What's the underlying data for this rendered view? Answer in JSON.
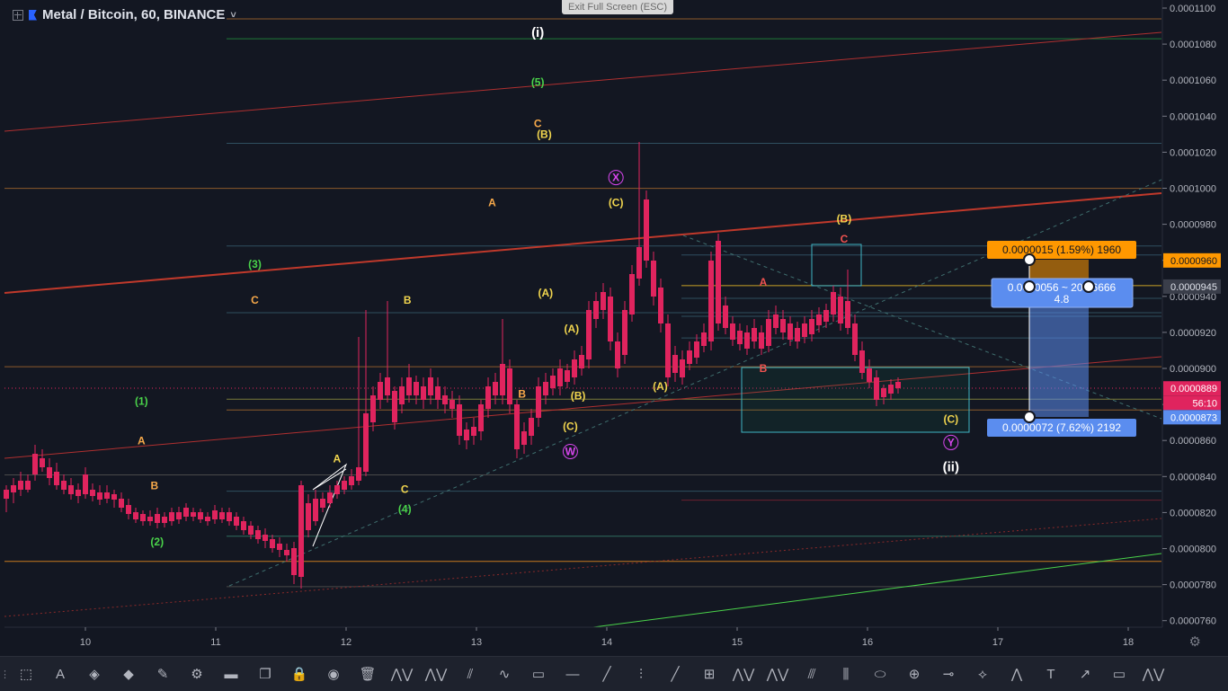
{
  "header": {
    "symbol_title": "Metal / Bitcoin, 60, BINANCE",
    "dropdown_glyph": "˅"
  },
  "fullscreen": {
    "exit_label": "Exit Full Screen (ESC)"
  },
  "colors": {
    "background": "#131722",
    "up_candle": "#26de6f",
    "down_candle": "#e0245e",
    "axis_text": "#b2b5be",
    "label_orange": "#f7a94a",
    "label_yellow": "#f1d54e",
    "label_green": "#4ad34a",
    "label_white": "#ffffff",
    "label_magenta": "#d946ef",
    "label_red": "#ef5350"
  },
  "price_axis": {
    "ticks": [
      "0.0001100",
      "0.0001080",
      "0.0001060",
      "0.0001040",
      "0.0001020",
      "0.0001000",
      "0.0000980",
      "0.0000960",
      "0.0000940",
      "0.0000920",
      "0.0000900",
      "0.0000880",
      "0.0000860",
      "0.0000840",
      "0.0000820",
      "0.0000800",
      "0.0000780",
      "0.0000760"
    ],
    "badges": [
      {
        "text": "0.0000960",
        "price": 9.6e-05,
        "bg": "#ff9800",
        "fg": "#131722"
      },
      {
        "text": "0.0000945",
        "price": 9.455e-05,
        "bg": "#3a3e4a",
        "fg": "#e0e3eb"
      },
      {
        "text": "0.0000889",
        "price": 8.89e-05,
        "bg": "#e0245e",
        "fg": "#ffffff"
      },
      {
        "text": "56:10",
        "price": 8.81e-05,
        "bg": "#e0245e",
        "fg": "#ffffff"
      },
      {
        "text": "0.0000873",
        "price": 8.73e-05,
        "bg": "#5b8def",
        "fg": "#ffffff"
      }
    ]
  },
  "time_axis": {
    "ticks": [
      "10",
      "11",
      "12",
      "13",
      "14",
      "15",
      "16",
      "17",
      "18"
    ]
  },
  "position_tool": {
    "target_label": "0.0000015 (1.59%) 1960",
    "middle_label_a": "0.0000056 ~ 20.66666",
    "middle_label_b": "4.8",
    "stop_label": "0.0000072 (7.62%) 2192"
  },
  "wave_labels": [
    {
      "text": "(i)",
      "color": "white",
      "xday": 13.47,
      "price": 0.0001084
    },
    {
      "text": "(5)",
      "color": "green",
      "xday": 13.47,
      "price": 0.0001057
    },
    {
      "text": "C",
      "color": "orange",
      "xday": 13.47,
      "price": 0.0001034
    },
    {
      "text": "(B)",
      "color": "yellow",
      "xday": 13.52,
      "price": 0.0001028
    },
    {
      "text": "A",
      "color": "orange",
      "xday": 13.12,
      "price": 9.9e-05
    },
    {
      "text": "X",
      "color": "magenta",
      "xday": 14.07,
      "price": 0.0001004,
      "circled": true
    },
    {
      "text": "(C)",
      "color": "yellow",
      "xday": 14.07,
      "price": 9.9e-05
    },
    {
      "text": "(3)",
      "color": "green",
      "xday": 11.3,
      "price": 9.56e-05
    },
    {
      "text": "C",
      "color": "orange",
      "xday": 11.3,
      "price": 9.36e-05
    },
    {
      "text": "B",
      "color": "yellow",
      "xday": 12.47,
      "price": 9.36e-05
    },
    {
      "text": "(A)",
      "color": "yellow",
      "xday": 13.53,
      "price": 9.4e-05
    },
    {
      "text": "(A)",
      "color": "yellow",
      "xday": 13.73,
      "price": 9.2e-05
    },
    {
      "text": "B",
      "color": "orange",
      "xday": 13.35,
      "price": 8.84e-05
    },
    {
      "text": "(B)",
      "color": "yellow",
      "xday": 13.78,
      "price": 8.83e-05
    },
    {
      "text": "(C)",
      "color": "yellow",
      "xday": 13.72,
      "price": 8.66e-05
    },
    {
      "text": "W",
      "color": "magenta",
      "xday": 13.72,
      "price": 8.52e-05,
      "circled": true
    },
    {
      "text": "(B)",
      "color": "yellow",
      "xday": 8.63,
      "price": 8.93e-05
    },
    {
      "text": "(1)",
      "color": "green",
      "xday": 10.43,
      "price": 8.8e-05
    },
    {
      "text": "A",
      "color": "orange",
      "xday": 10.43,
      "price": 8.58e-05
    },
    {
      "text": "B",
      "color": "orange",
      "xday": 10.53,
      "price": 8.33e-05
    },
    {
      "text": "A",
      "color": "yellow",
      "xday": 11.93,
      "price": 8.48e-05
    },
    {
      "text": "C",
      "color": "yellow",
      "xday": 12.45,
      "price": 8.31e-05
    },
    {
      "text": "(4)",
      "color": "green",
      "xday": 12.45,
      "price": 8.2e-05
    },
    {
      "text": "(2)",
      "color": "green",
      "xday": 10.55,
      "price": 8.02e-05
    },
    {
      "text": "(B)",
      "color": "yellow",
      "xday": 15.82,
      "price": 9.81e-05
    },
    {
      "text": "C",
      "color": "red",
      "xday": 15.82,
      "price": 9.7e-05
    },
    {
      "text": "A",
      "color": "red",
      "xday": 15.2,
      "price": 9.46e-05
    },
    {
      "text": "B",
      "color": "red",
      "xday": 15.2,
      "price": 8.98e-05
    },
    {
      "text": "(A)",
      "color": "yellow",
      "xday": 14.41,
      "price": 8.88e-05
    },
    {
      "text": "(C)",
      "color": "yellow",
      "xday": 16.64,
      "price": 8.7e-05
    },
    {
      "text": "Y",
      "color": "magenta",
      "xday": 16.64,
      "price": 8.57e-05,
      "circled": true
    },
    {
      "text": "(ii)",
      "color": "white",
      "xday": 16.64,
      "price": 8.43e-05
    }
  ],
  "toolbar": {
    "tools": [
      "crosshair-icon",
      "line-tool-icon",
      "fill-icon",
      "color-fill-icon",
      "pencil-icon",
      "settings-icon",
      "template-icon",
      "clone-icon",
      "lock-icon",
      "eye-icon",
      "trash-icon",
      "wave-12345-icon",
      "wave-abc-icon",
      "pitchfork-icon",
      "path-icon",
      "rectangle-icon",
      "horizontal-line-icon",
      "pen-icon",
      "projection-icon",
      "ray-icon",
      "range-icon",
      "wave-wxy-icon",
      "wave-abcde-icon",
      "parallel-channel-icon",
      "gann-icon",
      "ellipse-icon",
      "crosshair-box-icon",
      "horizontal-ray-icon",
      "pattern-icon",
      "head-shoulders-icon",
      "text-icon",
      "arrow-line-icon",
      "callout-icon",
      "wave-wxyxz-icon"
    ],
    "labels": {
      "wave_12345": "1 5",
      "wave_abc": "A C",
      "wave_wxy": "W Y",
      "wave_abcde": "A E",
      "wave_wxyxz": "W Z"
    }
  }
}
